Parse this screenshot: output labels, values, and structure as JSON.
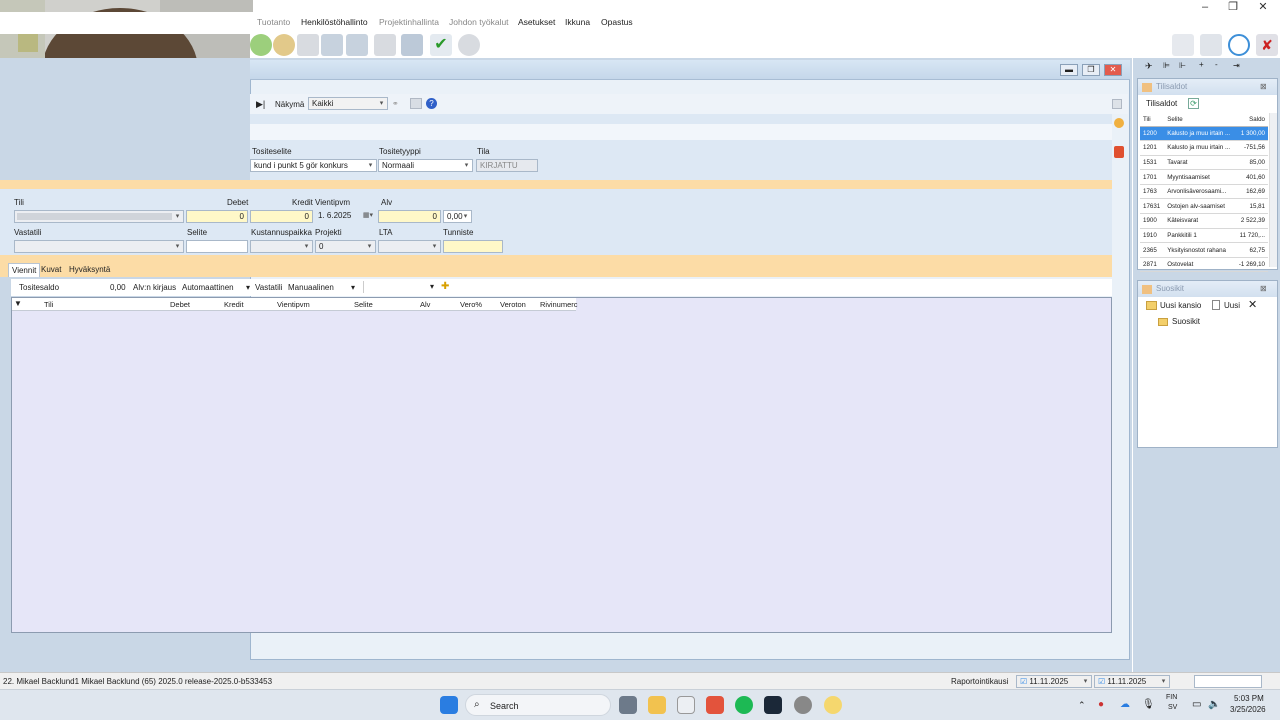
{
  "menu": {
    "items": [
      {
        "label": "Tuotanto",
        "disabled": true
      },
      {
        "label": "Henkilöstöhallinto",
        "disabled": false
      },
      {
        "label": "Projektinhallinta",
        "disabled": true
      },
      {
        "label": "Johdon työkalut",
        "disabled": true
      },
      {
        "label": "Asetukset",
        "disabled": false
      },
      {
        "label": "Ikkuna",
        "disabled": false
      },
      {
        "label": "Opastus",
        "disabled": false
      }
    ]
  },
  "voucher": {
    "view_label": "Näkymä",
    "view_value": "Kaikki",
    "tositeselite_label": "Tositeselite",
    "tositeselite_value": "kund i punkt 5 gör konkurs",
    "tositetyyppi_label": "Tositetyyppi",
    "tositetyyppi_value": "Normaali",
    "tila_label": "Tila",
    "tila_value": "KIRJATTU"
  },
  "entry": {
    "tili_label": "Tili",
    "debet_label": "Debet",
    "debet_value": "0",
    "kredit_label": "Kredit",
    "kredit_value": "0",
    "vientipvm_label": "Vientipvm",
    "vientipvm_value": "1.  6.2025",
    "alv_label": "Alv",
    "alv_value": "0",
    "alv_pct": "0,00",
    "vastatili_label": "Vastatili",
    "selite_label": "Selite",
    "kustannuspaikka_label": "Kustannuspaikka",
    "projekti_label": "Projekti",
    "projekti_value": "0",
    "lta_label": "LTA",
    "tunniste_label": "Tunniste"
  },
  "tabs": [
    "Viennit",
    "Kuvat",
    "Hyväksyntä"
  ],
  "summary": {
    "tositesaldo_label": "Tositesaldo",
    "tositesaldo_value": "0,00",
    "alv_kirjaus_label": "Alv:n kirjaus",
    "alv_kirjaus_value": "Automaattinen",
    "vastatili_label": "Vastatili",
    "vastatili_value": "Manuaalinen"
  },
  "grid": {
    "columns": [
      "Tili",
      "Debet",
      "Kredit",
      "Vientipvm",
      "Selite",
      "Alv",
      "Vero%",
      "Veroton",
      "Rivinumerc"
    ]
  },
  "balances_panel": {
    "title": "Tilisaldot",
    "tab": "Tilisaldot",
    "columns": [
      "Tili",
      "Selite",
      "Saldo"
    ],
    "rows": [
      {
        "tili": "1200",
        "selite": "Kalusto ja muu irtain ...",
        "saldo": "1 300,00"
      },
      {
        "tili": "1201",
        "selite": "Kalusto ja muu irtain ...",
        "saldo": "-751,56"
      },
      {
        "tili": "1531",
        "selite": "Tavarat",
        "saldo": "85,00"
      },
      {
        "tili": "1701",
        "selite": "Myyntisaamiset",
        "saldo": "401,60"
      },
      {
        "tili": "1763",
        "selite": "Arvonlisäverosaami...",
        "saldo": "162,69"
      },
      {
        "tili": "17631",
        "selite": "Ostojen alv-saamiset",
        "saldo": "15,81"
      },
      {
        "tili": "1900",
        "selite": "Käteisvarat",
        "saldo": "2 522,39"
      },
      {
        "tili": "1910",
        "selite": "Pankkitili 1",
        "saldo": "11 720,..."
      },
      {
        "tili": "2365",
        "selite": "Yksityisnostot rahana",
        "saldo": "62,75"
      },
      {
        "tili": "2871",
        "selite": "Ostovelat",
        "saldo": "-1 269,10"
      }
    ]
  },
  "favorites_panel": {
    "title": "Suosikit",
    "new_folder": "Uusi kansio",
    "new": "Uusi",
    "tree_root": "Suosikit"
  },
  "status": {
    "left": "22. Mikael Backlund1  Mikael Backlund (65)  2025.0 release-2025.0-b533453",
    "period_label": "Raportointikausi",
    "date1": "11.11.2025",
    "date2": "11.11.2025"
  },
  "taskbar": {
    "search": "Search",
    "lang1": "FIN",
    "lang2": "SV",
    "time": "5:03 PM",
    "date": "3/25/2026"
  },
  "colors": {
    "accent": "#3a8ee6",
    "band": "#fcdca6",
    "form_bg": "#dde8f4"
  }
}
